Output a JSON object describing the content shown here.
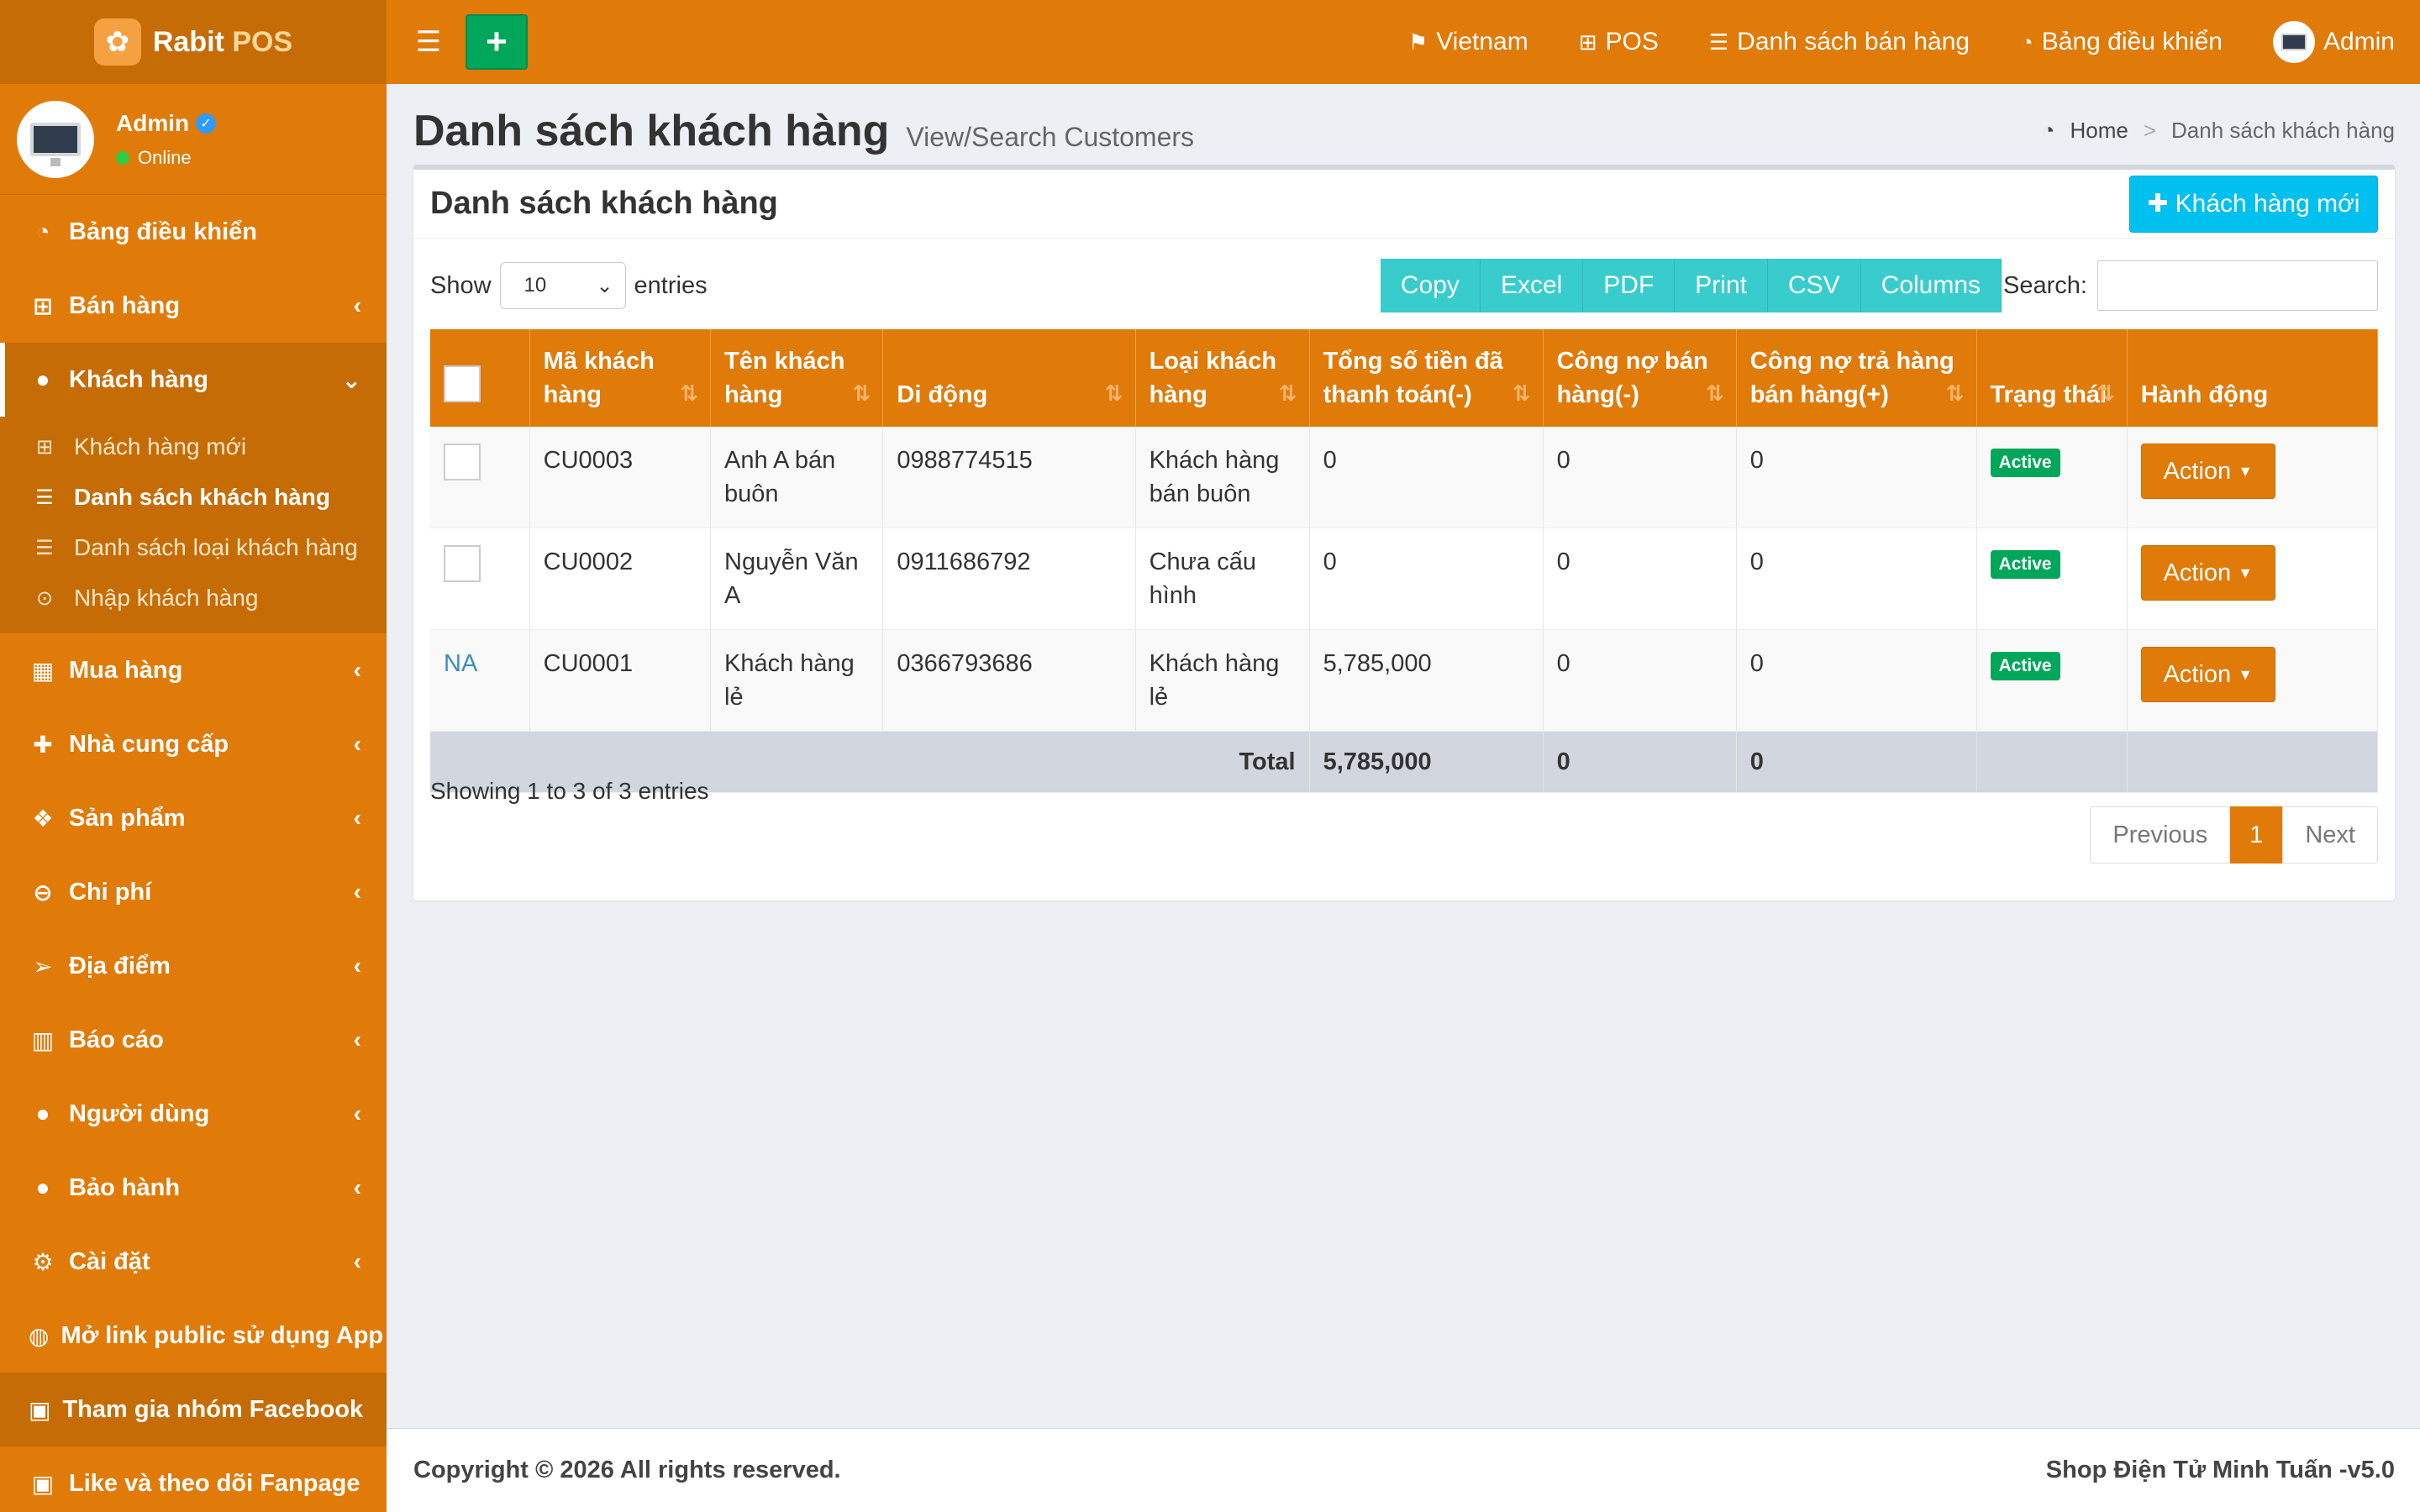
{
  "brand": {
    "name": "Rabit",
    "suffix": "POS",
    "logo_icon": "rabbit-logo"
  },
  "user_panel": {
    "name": "Admin",
    "status": "Online"
  },
  "sidebar": {
    "items": [
      {
        "label": "Bảng điều khiển",
        "icon": "dashboard-icon"
      },
      {
        "label": "Bán hàng",
        "icon": "cart-icon"
      },
      {
        "label": "Khách hàng",
        "icon": "users-icon"
      },
      {
        "label": "Mua hàng",
        "icon": "grid-icon"
      },
      {
        "label": "Nhà cung cấp",
        "icon": "user-plus-icon"
      },
      {
        "label": "Sản phẩm",
        "icon": "cubes-icon"
      },
      {
        "label": "Chi phí",
        "icon": "minus-circle-icon"
      },
      {
        "label": "Địa điểm",
        "icon": "paper-plane-icon"
      },
      {
        "label": "Báo cáo",
        "icon": "bar-chart-icon"
      },
      {
        "label": "Người dùng",
        "icon": "users-icon"
      },
      {
        "label": "Bảo hành",
        "icon": "users-icon"
      },
      {
        "label": "Cài đặt",
        "icon": "cogs-icon"
      },
      {
        "label": "Mở link public sử dụng App",
        "icon": "globe-icon"
      },
      {
        "label": "Tham gia nhóm Facebook",
        "icon": "briefcase-icon"
      },
      {
        "label": "Like và theo dõi Fanpage",
        "icon": "briefcase-icon"
      }
    ],
    "submenu": [
      {
        "label": "Khách hàng mới",
        "icon": "plus-square-icon"
      },
      {
        "label": "Danh sách khách hàng",
        "icon": "list-icon"
      },
      {
        "label": "Danh sách loại khách hàng",
        "icon": "list-icon"
      },
      {
        "label": "Nhập khách hàng",
        "icon": "arrow-circle-icon"
      }
    ]
  },
  "topbar": {
    "language": "Vietnam",
    "pos": "POS",
    "sales_list": "Danh sách bán hàng",
    "dashboard": "Bảng điều khiển",
    "user": "Admin"
  },
  "page": {
    "title": "Danh sách khách hàng",
    "subtitle": "View/Search Customers",
    "breadcrumb_home": "Home",
    "breadcrumb_sep": ">",
    "breadcrumb_current": "Danh sách khách hàng"
  },
  "box": {
    "title": "Danh sách khách hàng",
    "new_button": "Khách hàng mới"
  },
  "table_controls": {
    "show_label": "Show",
    "page_length": "10",
    "entries_label": "entries",
    "buttons": [
      "Copy",
      "Excel",
      "PDF",
      "Print",
      "CSV",
      "Columns"
    ],
    "search_label": "Search:",
    "search_value": ""
  },
  "table": {
    "headers": [
      "",
      "Mã khách hàng",
      "Tên khách hàng",
      "Di động",
      "Loại khách hàng",
      "Tổng số tiền đã thanh toán(-)",
      "Công nợ bán hàng(-)",
      "Công nợ trả hàng bán hàng(+)",
      "Trạng thái",
      "Hành động"
    ],
    "rows": [
      {
        "select": "",
        "code": "CU0003",
        "name": "Anh A bán buôn",
        "mobile": "0988774515",
        "type": "Khách hàng bán buôn",
        "paid": "0",
        "sales_due": "0",
        "return_due": "0",
        "status": "Active",
        "action": "Action"
      },
      {
        "select": "",
        "code": "CU0002",
        "name": "Nguyễn Văn A",
        "mobile": "0911686792",
        "type": "Chưa cấu hình",
        "paid": "0",
        "sales_due": "0",
        "return_due": "0",
        "status": "Active",
        "action": "Action"
      },
      {
        "select": "NA",
        "code": "CU0001",
        "name": "Khách hàng lẻ",
        "mobile": "0366793686",
        "type": "Khách hàng lẻ",
        "paid": "5,785,000",
        "sales_due": "0",
        "return_due": "0",
        "status": "Active",
        "action": "Action"
      }
    ],
    "total": {
      "label": "Total",
      "paid": "5,785,000",
      "sales_due": "0",
      "return_due": "0"
    }
  },
  "info": "Showing 1 to 3 of 3 entries",
  "pagination": {
    "previous": "Previous",
    "current": "1",
    "next": "Next"
  },
  "footer": {
    "copyright": "Copyright © 2026 All rights reserved.",
    "version": "Shop Điện Tử Minh Tuấn -v5.0"
  },
  "colors": {
    "primary": "#e07a08",
    "dark": "#c66c06",
    "teal": "#39cccc",
    "aqua": "#00c0ef",
    "green": "#00a65a"
  }
}
